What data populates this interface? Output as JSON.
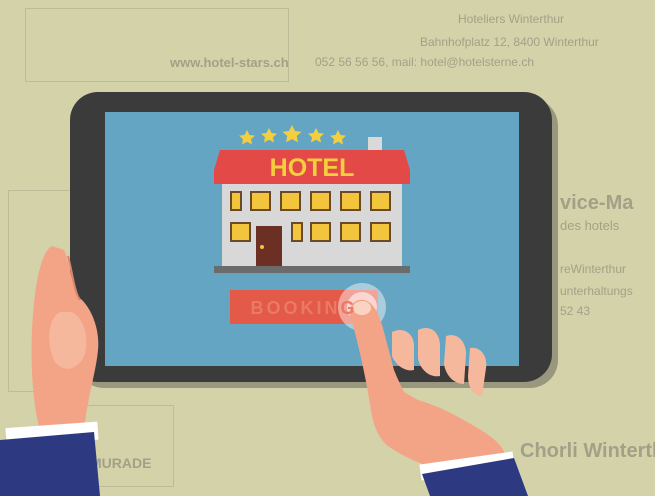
{
  "hotel_sign": "HOTEL",
  "booking_button": "BOOKING",
  "background_print": {
    "top_logo": "www.hotel-stars.ch",
    "top_lines": [
      "Hoteliers Winterthur",
      "Bahnhofplatz 12, 8400 Winterthur",
      "052 56 56 56, mail: hotel@hotelsterne.ch"
    ],
    "right_heading": "vice-Ma",
    "right_sub": "des hotels",
    "right_lines": [
      "reWinterthur",
      "unterhaltungs",
      "52 43"
    ],
    "bottom_right": "Chorli Winterthur",
    "bottom_left": "MURADE"
  },
  "colors": {
    "screen": "#64a5c4",
    "tablet_frame": "#3b3b3b",
    "sign": "#e34a47",
    "button": "#e35a48",
    "sleeve": "#2d3a82",
    "skin": "#f3a487"
  }
}
